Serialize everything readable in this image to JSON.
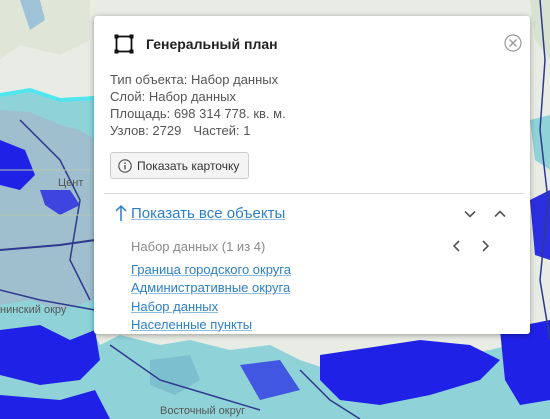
{
  "map": {
    "labels": [
      "Цент",
      "нинский окру",
      "Восточный округ"
    ],
    "colors": {
      "land": "#e8ece4",
      "water": "#8fd3d9",
      "selection": "#1f22e6",
      "outline": "#2f3a8f",
      "aqua": "#52e5ee"
    }
  },
  "popup": {
    "title": "Генеральный план",
    "info": {
      "type": "Тип объекта: Набор данных",
      "layer": "Слой: Набор данных",
      "area": "Площадь: 698 314 778. кв. м.",
      "nodes": "Узлов: 2729",
      "parts": "Частей: 1"
    },
    "card_button": "Показать карточку",
    "show_all": "Показать все объекты",
    "nav_title": "Набор данных (1 из 4)",
    "items": [
      "Граница городского округа",
      "Административные округа",
      "Набор данных",
      "Населенные пункты"
    ]
  },
  "icons": {
    "header": "polygon-select-icon",
    "close": "close-circle-icon",
    "info": "info-icon",
    "arrow": "arrow-up-icon",
    "collapse": "chevron-down-icon",
    "expand": "chevron-up-icon",
    "prev": "chevron-left-icon",
    "next": "chevron-right-icon"
  }
}
